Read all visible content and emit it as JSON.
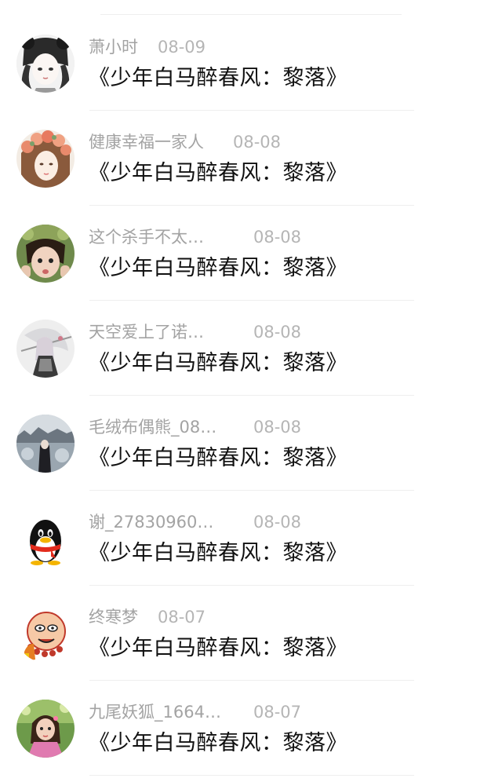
{
  "items": [
    {
      "name": "萧小时",
      "date": "08-09",
      "title": "《少年白马醉春风：黎落》",
      "avatar_icon": "avatar-anime-girl-panda-hat"
    },
    {
      "name": "健康幸福一家人",
      "date": "08-08",
      "title": "《少年白马醉春风：黎落》",
      "avatar_icon": "avatar-flower-crown-girl"
    },
    {
      "name": "这个杀手不太…",
      "date": "08-08",
      "title": "《少年白马醉春风：黎落》",
      "avatar_icon": "avatar-child-photo"
    },
    {
      "name": "天空爱上了诺…",
      "date": "08-08",
      "title": "《少年白马醉春风：黎落》",
      "avatar_icon": "avatar-anime-swordswoman"
    },
    {
      "name": "毛绒布偶熊_08…",
      "date": "08-08",
      "title": "《少年白马醉春风：黎落》",
      "avatar_icon": "avatar-winter-landscape"
    },
    {
      "name": "谢_27830960…",
      "date": "08-08",
      "title": "《少年白马醉春风：黎落》",
      "avatar_icon": "avatar-qq-penguin"
    },
    {
      "name": "终寒梦",
      "date": "08-07",
      "title": "《少年白马醉春风：黎落》",
      "avatar_icon": "avatar-cartoon-monk"
    },
    {
      "name": "九尾妖狐_1664…",
      "date": "08-07",
      "title": "《少年白马醉春风：黎落》",
      "avatar_icon": "avatar-girl-photo"
    }
  ]
}
